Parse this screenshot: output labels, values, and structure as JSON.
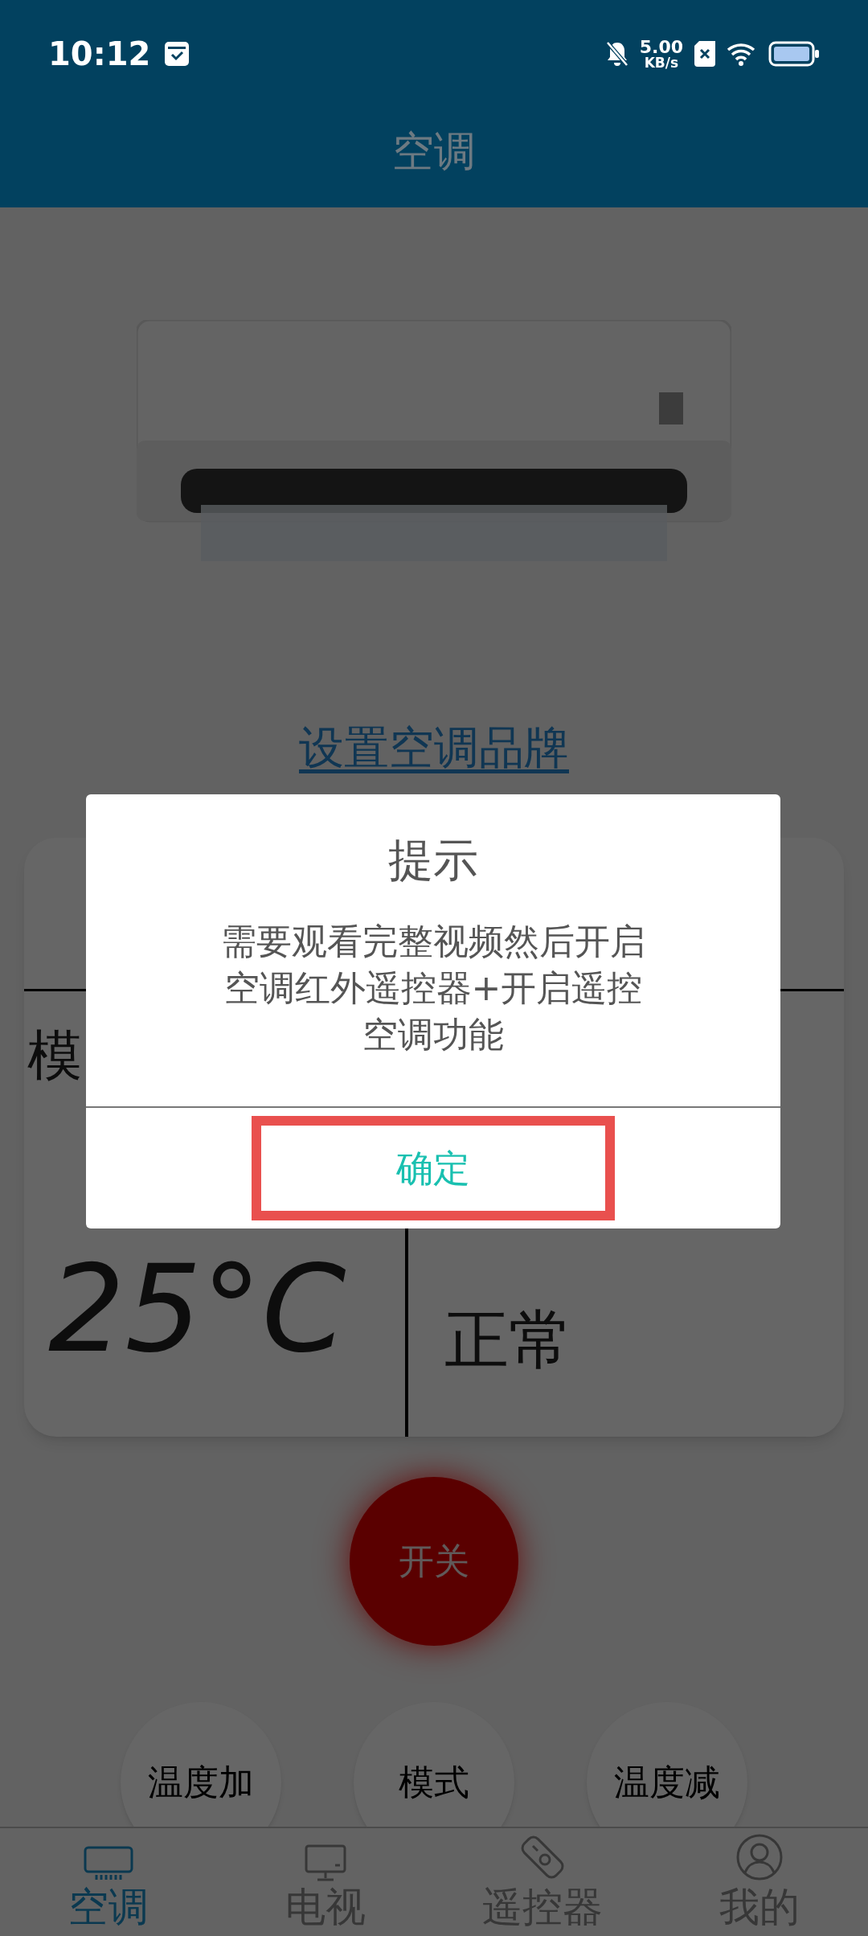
{
  "status_bar": {
    "time": "10:12",
    "network_speed": "5.00",
    "speed_unit": "KB/s"
  },
  "header": {
    "title": "空调"
  },
  "brand_link": "设置空调品牌",
  "panel": {
    "mode_label": "模",
    "temperature": "25°C",
    "status": "正常"
  },
  "power_button": "开关",
  "control_buttons": [
    "温度加",
    "模式",
    "温度减"
  ],
  "tabs": [
    {
      "label": "空调",
      "kind": "ac",
      "selected": true
    },
    {
      "label": "电视",
      "kind": "tv",
      "selected": false
    },
    {
      "label": "遥控器",
      "kind": "remote",
      "selected": false
    },
    {
      "label": "我的",
      "kind": "user",
      "selected": false
    }
  ],
  "dialog": {
    "title": "提示",
    "message": "需要观看完整视频然后开启空调红外遥控器+开启遥控空调功能",
    "confirm": "确定"
  }
}
